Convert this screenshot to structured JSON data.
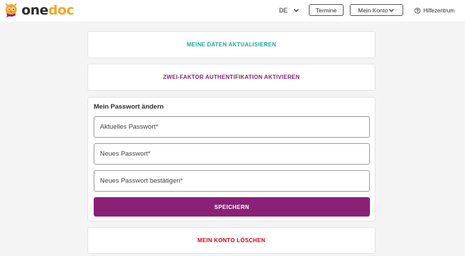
{
  "header": {
    "logo_text_part1": "one",
    "logo_text_part2": "doc",
    "language": "DE",
    "termine_label": "Termine",
    "account_label": "Mein Konto",
    "help_label": "Hilfezentrum"
  },
  "actions": {
    "update_data_label": "MEINE DATEN AKTUALISIEREN",
    "two_factor_label": "ZWEI-FAKTOR AUTHENTIFIKATION AKTIVIEREN",
    "delete_account_label": "MEIN KONTO LÖSCHEN"
  },
  "password_form": {
    "title": "Mein Passwort ändern",
    "current_placeholder": "Aktuelles Passwort*",
    "new_placeholder": "Neues Passwort*",
    "confirm_placeholder": "Neues Passwort bestätigen*",
    "save_label": "SPEICHERN"
  },
  "colors": {
    "brand_purple": "#8a2177",
    "teal": "#1aa89a",
    "danger_red": "#d0021b",
    "logo_orange": "#f5a623"
  },
  "icons": {
    "logo": "onedoc-mascot-icon",
    "language_dropdown": "chevron-down-icon",
    "account_dropdown": "chevron-down-icon",
    "help": "question-circle-icon"
  }
}
